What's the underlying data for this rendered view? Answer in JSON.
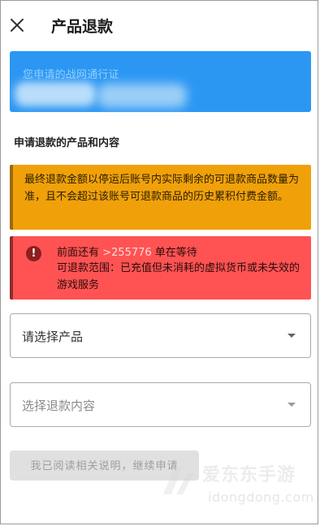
{
  "header": {
    "close_icon": "close-icon",
    "title": "产品退款"
  },
  "account_card": {
    "label": "您申请的战网通行证",
    "background_color": "#2c97f3"
  },
  "section": {
    "title": "申请退款的产品和内容"
  },
  "notices": {
    "orange": {
      "text": "最终退款金额以停运后账号内实际剩余的可退款商品数量为准，且不会超过该账号可退款商品的历史累积付费金额。",
      "color": "#f0a10a"
    },
    "red": {
      "icon": "info-icon",
      "icon_glyph": "!",
      "queue_prefix": "前面还有 ",
      "queue_count": ">255776",
      "queue_suffix": " 单在等待",
      "scope_text": "可退款范围：已充值但未消耗的虚拟货币或未失效的游戏服务",
      "color": "#ff5353"
    }
  },
  "selects": {
    "product": {
      "label": "请选择产品",
      "icon": "chevron-down-icon"
    },
    "content": {
      "label": "选择退款内容",
      "icon": "chevron-down-icon"
    }
  },
  "confirm_button": {
    "label": "我已阅读相关说明，继续申请"
  },
  "watermark": {
    "text": "爱东东手游",
    "domain": "idongdong.com"
  }
}
